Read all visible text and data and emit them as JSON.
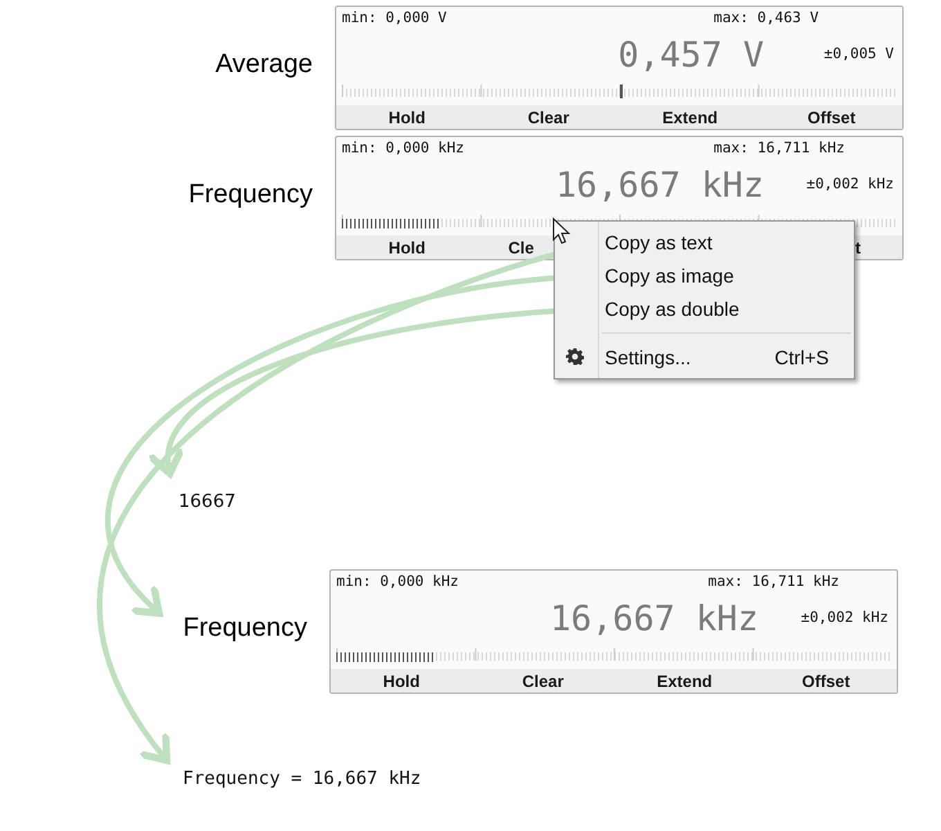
{
  "meters": [
    {
      "label": "Average",
      "min": "min: 0,000 V",
      "max": "max: 0,463 V",
      "value": "0,457 V",
      "tolerance": "±0,005 V",
      "scale": {
        "kind": "pointer",
        "level": 0.5
      },
      "buttons": [
        "Hold",
        "Clear",
        "Extend",
        "Offset"
      ]
    },
    {
      "label": "Frequency",
      "min": "min: 0,000 kHz",
      "max": "max: 16,711 kHz",
      "value": "16,667 kHz",
      "tolerance": "±0,002 kHz",
      "scale": {
        "kind": "bar",
        "level": 0.175
      },
      "buttons": [
        "Hold",
        "Cle",
        "t"
      ]
    },
    {
      "label": "Frequency",
      "min": "min: 0,000 kHz",
      "max": "max: 16,711 kHz",
      "value": "16,667 kHz",
      "tolerance": "±0,002 kHz",
      "scale": {
        "kind": "bar",
        "level": 0.175
      },
      "buttons": [
        "Hold",
        "Clear",
        "Extend",
        "Offset"
      ]
    }
  ],
  "context_menu": {
    "items": [
      {
        "kind": "command",
        "label": "Copy as text"
      },
      {
        "kind": "command",
        "label": "Copy as image"
      },
      {
        "kind": "command",
        "label": "Copy as double"
      },
      {
        "kind": "settings",
        "label": "Settings...",
        "shortcut": "Ctrl+S"
      }
    ]
  },
  "pasted_texts": [
    {
      "kind": "plain",
      "text": "16667"
    },
    {
      "kind": "mono",
      "text": "Frequency = 16,667 kHz"
    }
  ]
}
